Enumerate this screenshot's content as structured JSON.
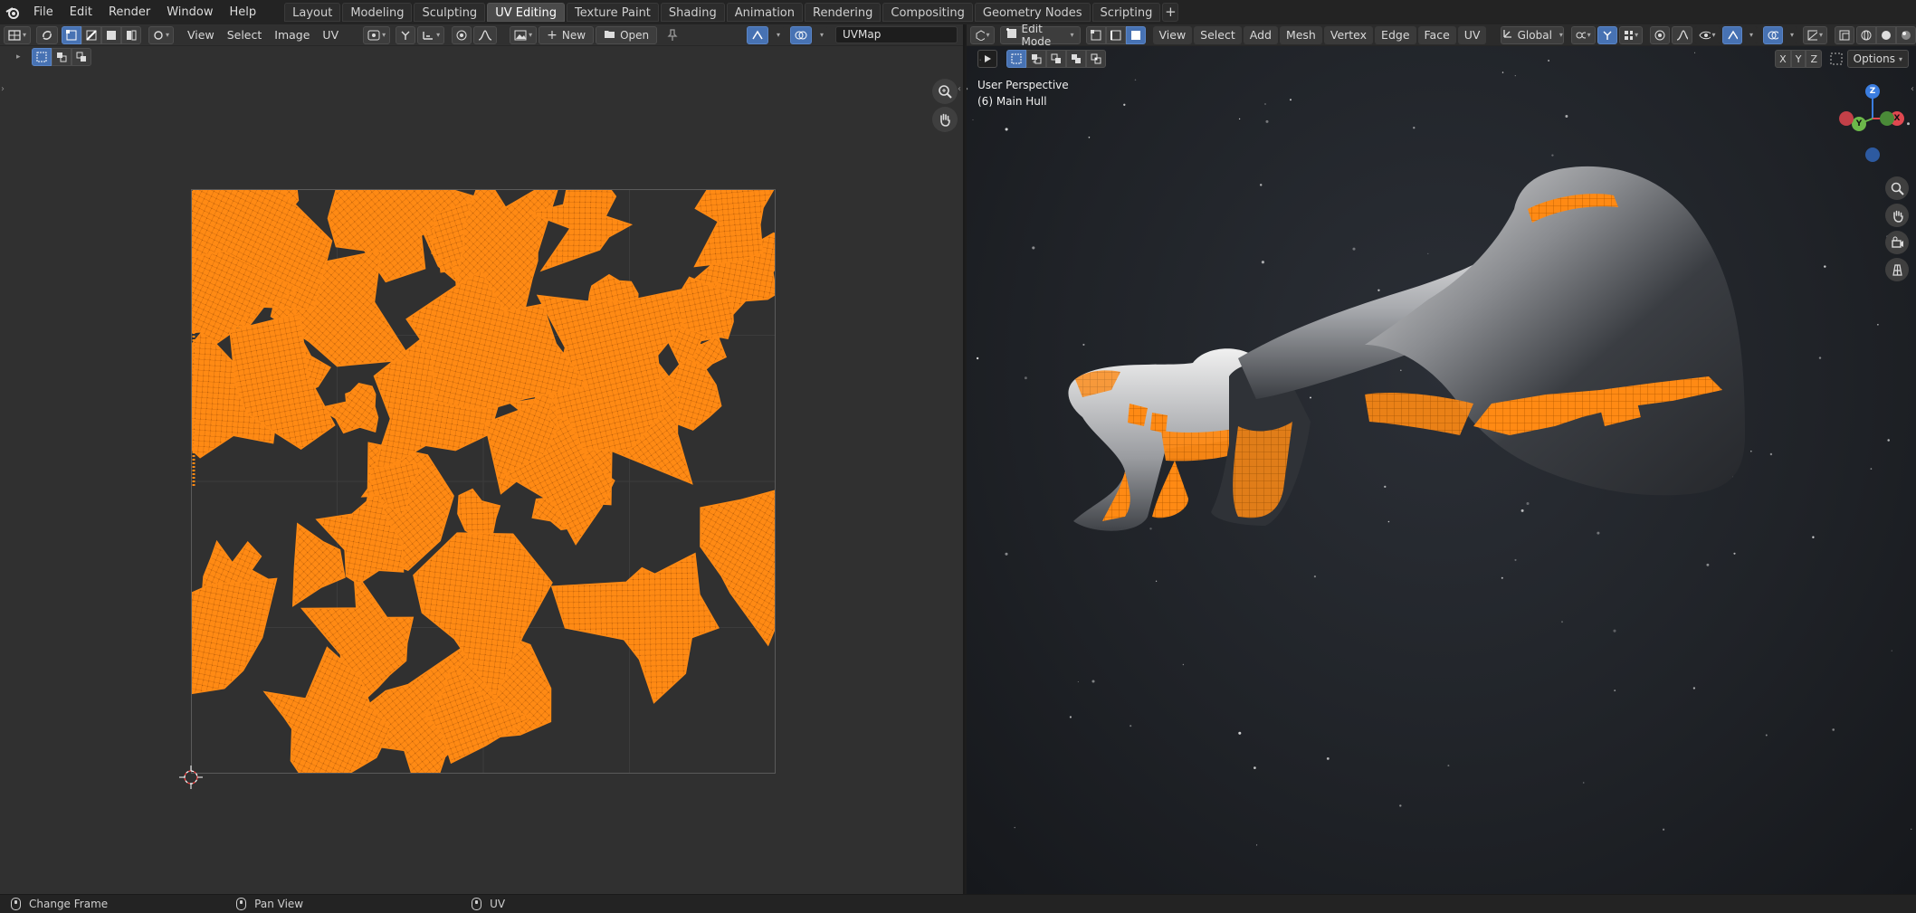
{
  "topbar": {
    "menus": [
      "File",
      "Edit",
      "Render",
      "Window",
      "Help"
    ],
    "workspace_tabs": [
      "Layout",
      "Modeling",
      "Sculpting",
      "UV Editing",
      "Texture Paint",
      "Shading",
      "Animation",
      "Rendering",
      "Compositing",
      "Geometry Nodes",
      "Scripting"
    ],
    "active_tab": "UV Editing",
    "add_tab": "+"
  },
  "uv_editor": {
    "menus": [
      "View",
      "Select",
      "Image",
      "UV"
    ],
    "new_label": "New",
    "open_label": "Open",
    "uvmap_field": "UVMap",
    "uv_island_color": "#ff8a14",
    "pin_icon": "pin-icon"
  },
  "viewport": {
    "mode": "Edit Mode",
    "menus": [
      "View",
      "Select",
      "Add",
      "Mesh",
      "Vertex",
      "Edge",
      "Face",
      "UV"
    ],
    "transform_orientation": "Global",
    "axis_toggles": [
      "X",
      "Y",
      "Z"
    ],
    "options_label": "Options",
    "perspective_label": "User Perspective",
    "object_label": "(6) Main Hull",
    "gizmo_axes": {
      "z": "Z",
      "y": "Y",
      "x": "X"
    },
    "accent": "#ff8a14"
  },
  "statusbar": {
    "items": [
      "Change Frame",
      "Pan View",
      "UV"
    ]
  }
}
